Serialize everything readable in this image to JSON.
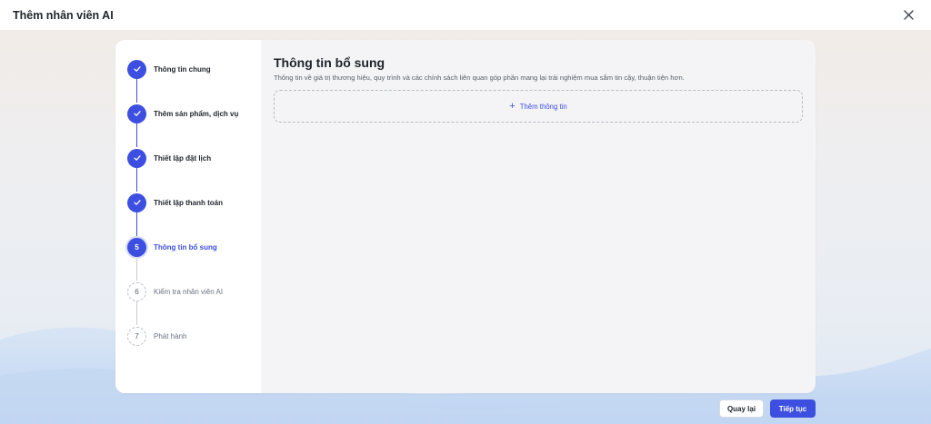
{
  "window": {
    "title": "Thêm nhân viên AI"
  },
  "steps": [
    {
      "number": "1",
      "label": "Thông tin chung",
      "state": "done"
    },
    {
      "number": "2",
      "label": "Thêm sản phẩm, dịch vụ",
      "state": "done"
    },
    {
      "number": "3",
      "label": "Thiết lập đặt lịch",
      "state": "done"
    },
    {
      "number": "4",
      "label": "Thiết lập thanh toán",
      "state": "done"
    },
    {
      "number": "5",
      "label": "Thông tin bổ sung",
      "state": "active"
    },
    {
      "number": "6",
      "label": "Kiểm tra nhân viên AI",
      "state": "pending"
    },
    {
      "number": "7",
      "label": "Phát hành",
      "state": "pending"
    }
  ],
  "main": {
    "title": "Thông tin bổ sung",
    "description": "Thông tin về giá trị thương hiệu, quy trình và các chính sách liên quan góp phần mang lại trải nghiệm mua sắm tin cậy, thuận tiện hơn.",
    "add_label": "Thêm thông tin"
  },
  "footer": {
    "back_label": "Quay lại",
    "next_label": "Tiếp tục"
  },
  "colors": {
    "accent": "#3d4fe0",
    "pending_border": "#b8bcc6"
  },
  "icons": {
    "close": "close-icon",
    "check": "check-icon",
    "plus": "plus-icon"
  }
}
